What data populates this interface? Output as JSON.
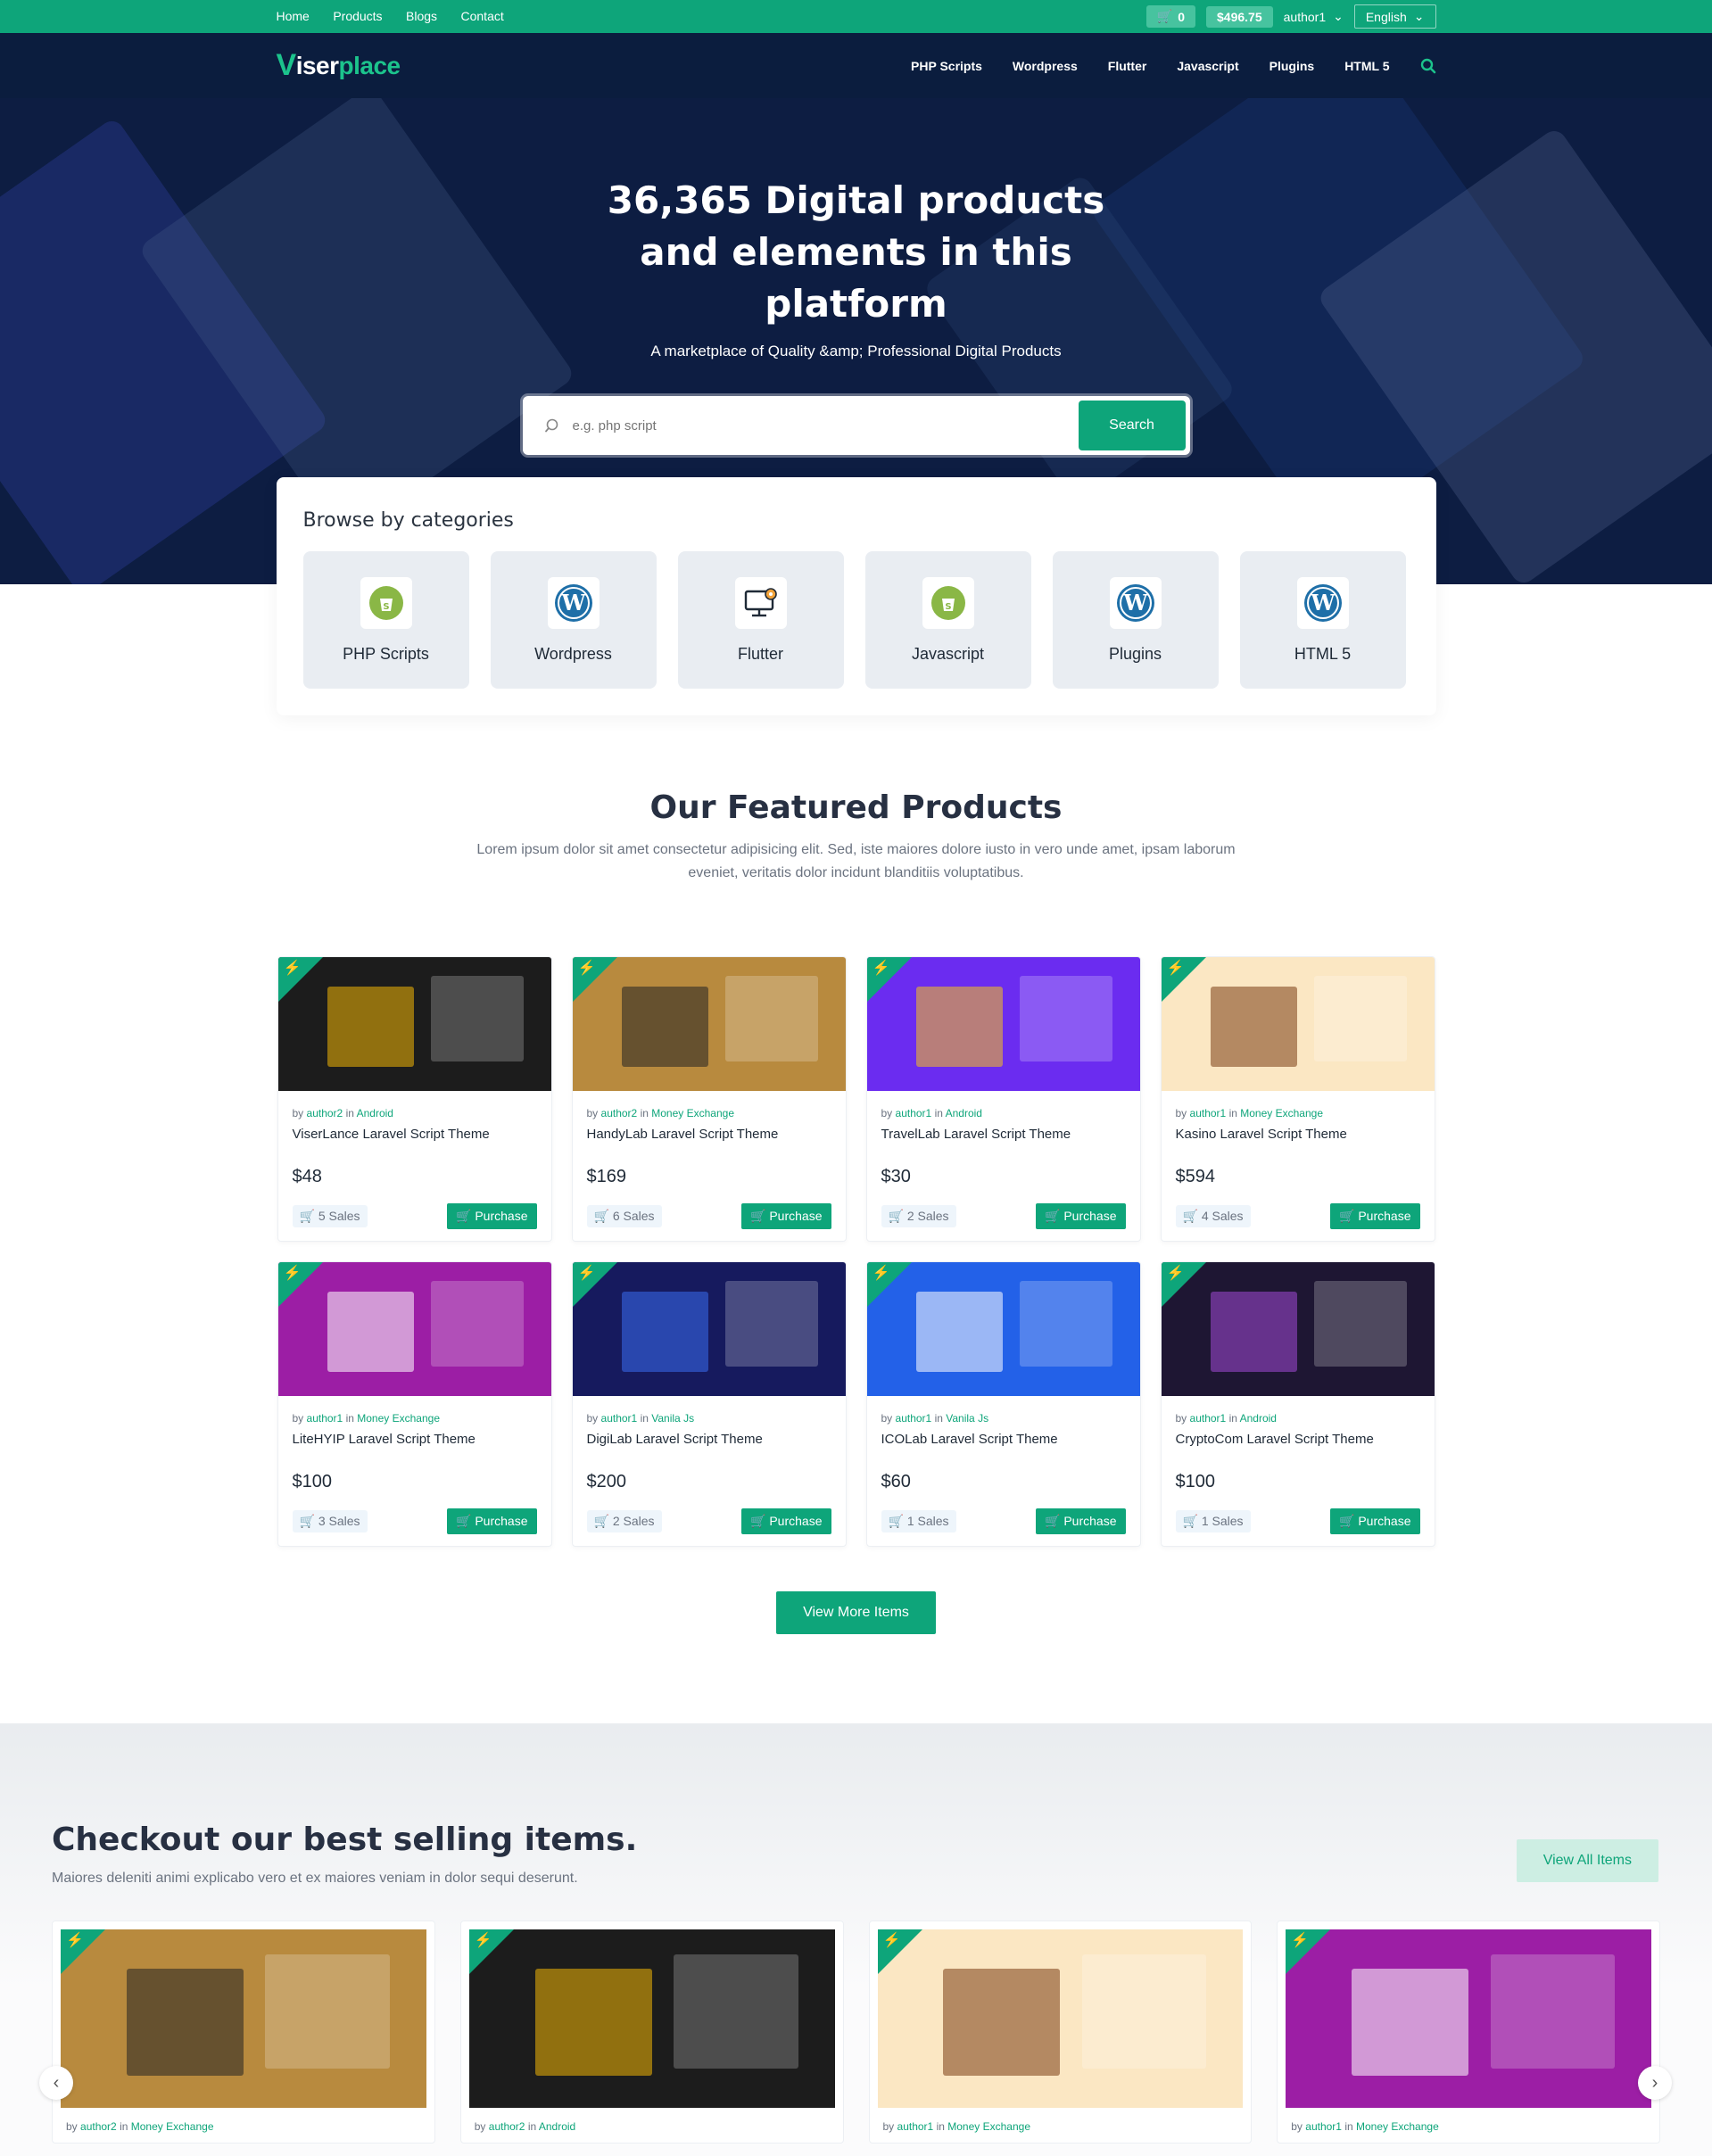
{
  "topbar": {
    "nav": [
      "Home",
      "Products",
      "Blogs",
      "Contact"
    ],
    "cart_count": "0",
    "balance": "$496.75",
    "user": "author1",
    "language": "English"
  },
  "header": {
    "logo_first": "iser",
    "logo_second": "place",
    "menu": [
      "PHP Scripts",
      "Wordpress",
      "Flutter",
      "Javascript",
      "Plugins",
      "HTML 5"
    ]
  },
  "hero": {
    "title": "36,365 Digital products and elements in this platform",
    "subtitle": "A marketplace of Quality &amp; Professional Digital Products",
    "search_placeholder": "e.g. php script",
    "search_button": "Search"
  },
  "categories": {
    "title": "Browse by categories",
    "items": [
      {
        "label": "PHP Scripts",
        "icon": "shopify-icon"
      },
      {
        "label": "Wordpress",
        "icon": "wordpress-icon"
      },
      {
        "label": "Flutter",
        "icon": "monitor-gear-icon"
      },
      {
        "label": "Javascript",
        "icon": "shopify-icon"
      },
      {
        "label": "Plugins",
        "icon": "wordpress-icon"
      },
      {
        "label": "HTML 5",
        "icon": "wordpress-icon"
      }
    ]
  },
  "featured": {
    "title": "Our Featured Products",
    "subtitle": "Lorem ipsum dolor sit amet consectetur adipisicing elit. Sed, iste maiores dolore iusto in vero unde amet, ipsam laborum eveniet, veritatis dolor incidunt blanditiis voluptatibus.",
    "products": [
      {
        "author": "author2",
        "category": "Android",
        "title": "ViserLance Laravel Script Theme",
        "price": "$48",
        "sales": "5 Sales",
        "thumb": "#1c1c1c",
        "accent": "#f2b705"
      },
      {
        "author": "author2",
        "category": "Money Exchange",
        "title": "HandyLab Laravel Script Theme",
        "price": "$169",
        "sales": "6 Sales",
        "thumb": "#b88a3e",
        "accent": "#222222"
      },
      {
        "author": "author1",
        "category": "Android",
        "title": "TravelLab Laravel Script Theme",
        "price": "$30",
        "sales": "2 Sales",
        "thumb": "#6b2cf0",
        "accent": "#f8c21a"
      },
      {
        "author": "author1",
        "category": "Money Exchange",
        "title": "Kasino Laravel Script Theme",
        "price": "$594",
        "sales": "4 Sales",
        "thumb": "#fbe7c3",
        "accent": "#7a3d12"
      },
      {
        "author": "author1",
        "category": "Money Exchange",
        "title": "LiteHYIP Laravel Script Theme",
        "price": "$100",
        "sales": "3 Sales",
        "thumb": "#9c1ea5",
        "accent": "#ffffff"
      },
      {
        "author": "author1",
        "category": "Vanila Js",
        "title": "DigiLab Laravel Script Theme",
        "price": "$200",
        "sales": "2 Sales",
        "thumb": "#161a5e",
        "accent": "#3b6df0"
      },
      {
        "author": "author1",
        "category": "Vanila Js",
        "title": "ICOLab Laravel Script Theme",
        "price": "$60",
        "sales": "1 Sales",
        "thumb": "#2361e8",
        "accent": "#ffffff"
      },
      {
        "author": "author1",
        "category": "Android",
        "title": "CryptoCom Laravel Script Theme",
        "price": "$100",
        "sales": "1 Sales",
        "thumb": "#1e1633",
        "accent": "#a24bd6"
      }
    ],
    "by_label": "by",
    "in_label": "in",
    "purchase_label": "Purchase",
    "view_more": "View More Items"
  },
  "best": {
    "title": "Checkout our best selling items.",
    "subtitle": "Maiores deleniti animi explicabo vero et ex maiores veniam in dolor sequi deserunt.",
    "view_all": "View All Items",
    "items": [
      {
        "author": "author2",
        "category": "Money Exchange",
        "thumb": "#b88a3e",
        "accent": "#222222"
      },
      {
        "author": "author2",
        "category": "Android",
        "thumb": "#1c1c1c",
        "accent": "#f2b705"
      },
      {
        "author": "author1",
        "category": "Money Exchange",
        "thumb": "#fbe7c3",
        "accent": "#7a3d12"
      },
      {
        "author": "author1",
        "category": "Money Exchange",
        "thumb": "#9c1ea5",
        "accent": "#ffffff"
      }
    ]
  },
  "colors": {
    "brand": "#0ea57a",
    "navy": "#0b1d3e"
  }
}
